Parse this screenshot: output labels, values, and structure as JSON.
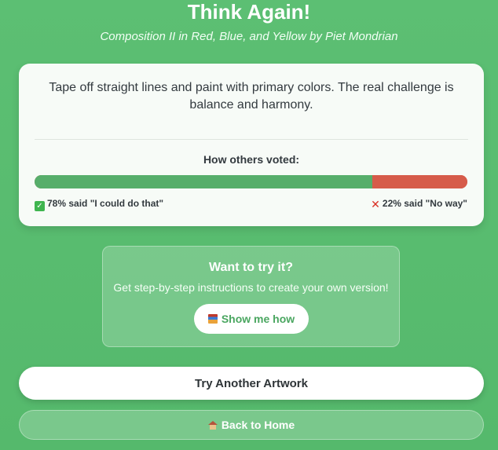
{
  "header": {
    "title": "Think Again!",
    "subtitle": "Composition II in Red, Blue, and Yellow by Piet Mondrian"
  },
  "result_card": {
    "description": "Tape off straight lines and paint with primary colors. The real challenge is balance and harmony.",
    "votes_heading": "How others voted:",
    "yes_percent": 78,
    "no_percent": 22,
    "yes_label": "78% said \"I could do that\"",
    "no_label": "22% said \"No way\"",
    "yes_icon": "check-mark-icon",
    "no_icon": "cross-mark-icon"
  },
  "try_box": {
    "title": "Want to try it?",
    "description": "Get step-by-step instructions to create your own version!",
    "button_label": "Show me how",
    "button_icon": "books-icon"
  },
  "actions": {
    "try_another_label": "Try Another Artwork",
    "back_home_label": "Back to Home",
    "back_home_icon": "house-icon"
  },
  "colors": {
    "background": "#5cbf73",
    "yes_bar": "#57ae6b",
    "no_bar": "#d65b4a",
    "button_text_green": "#4aa660"
  }
}
